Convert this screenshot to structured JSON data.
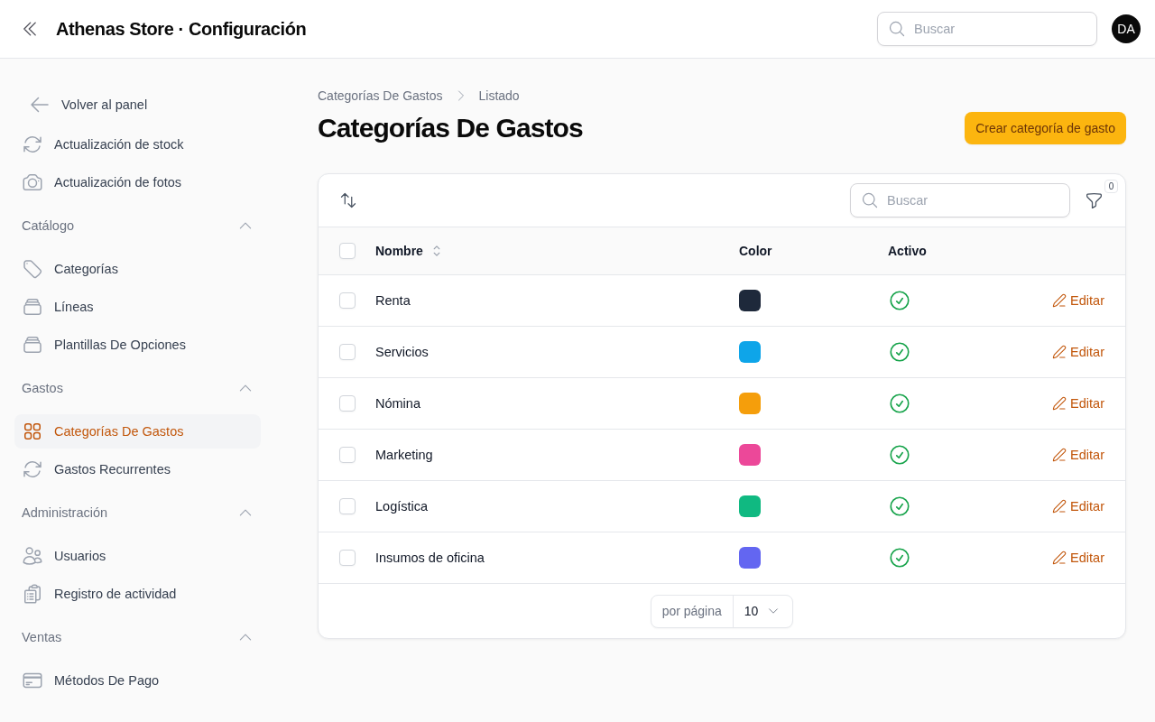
{
  "header": {
    "title": "Athenas Store · Configuración",
    "search": {
      "placeholder": "Buscar"
    },
    "avatar": "DA"
  },
  "sidebar": {
    "back": "Volver al panel",
    "items": [
      {
        "label": "Actualización de stock",
        "selected": false
      },
      {
        "label": "Actualización de fotos",
        "selected": false
      }
    ],
    "groups": [
      {
        "label": "Catálogo",
        "expanded": true,
        "items": [
          {
            "label": "Categorías",
            "selected": false
          },
          {
            "label": "Líneas",
            "selected": false
          },
          {
            "label": "Plantillas De Opciones",
            "selected": false
          }
        ]
      },
      {
        "label": "Gastos",
        "expanded": true,
        "items": [
          {
            "label": "Categorías De Gastos",
            "selected": true
          },
          {
            "label": "Gastos Recurrentes",
            "selected": false
          }
        ]
      },
      {
        "label": "Administración",
        "expanded": true,
        "items": [
          {
            "label": "Usuarios",
            "selected": false
          },
          {
            "label": "Registro de actividad",
            "selected": false
          }
        ]
      },
      {
        "label": "Ventas",
        "expanded": true,
        "items": [
          {
            "label": "Métodos De Pago",
            "selected": false
          }
        ]
      }
    ]
  },
  "main": {
    "breadcrumbs": [
      "Categorías De Gastos",
      "Listado"
    ],
    "title": "Categorías De Gastos",
    "create_button": "Crear categoría de gasto",
    "table": {
      "search": {
        "placeholder": "Buscar"
      },
      "filter_count": "0",
      "all_checked": false,
      "columns": [
        {
          "label": "Nombre",
          "sortable": true
        },
        {
          "label": "Color",
          "sortable": false
        },
        {
          "label": "Activo",
          "sortable": false
        }
      ],
      "rows": [
        {
          "name": "Renta",
          "color": "#1e293b",
          "active": true,
          "checked": false,
          "action": "Editar"
        },
        {
          "name": "Servicios",
          "color": "#0ea5e9",
          "active": true,
          "checked": false,
          "action": "Editar"
        },
        {
          "name": "Nómina",
          "color": "#f59e0b",
          "active": true,
          "checked": false,
          "action": "Editar"
        },
        {
          "name": "Marketing",
          "color": "#ec4899",
          "active": true,
          "checked": false,
          "action": "Editar"
        },
        {
          "name": "Logística",
          "color": "#10b981",
          "active": true,
          "checked": false,
          "action": "Editar"
        },
        {
          "name": "Insumos de oficina",
          "color": "#6366f1",
          "active": true,
          "checked": false,
          "action": "Editar"
        }
      ],
      "pagination": {
        "label": "por página",
        "value": "10"
      }
    }
  }
}
